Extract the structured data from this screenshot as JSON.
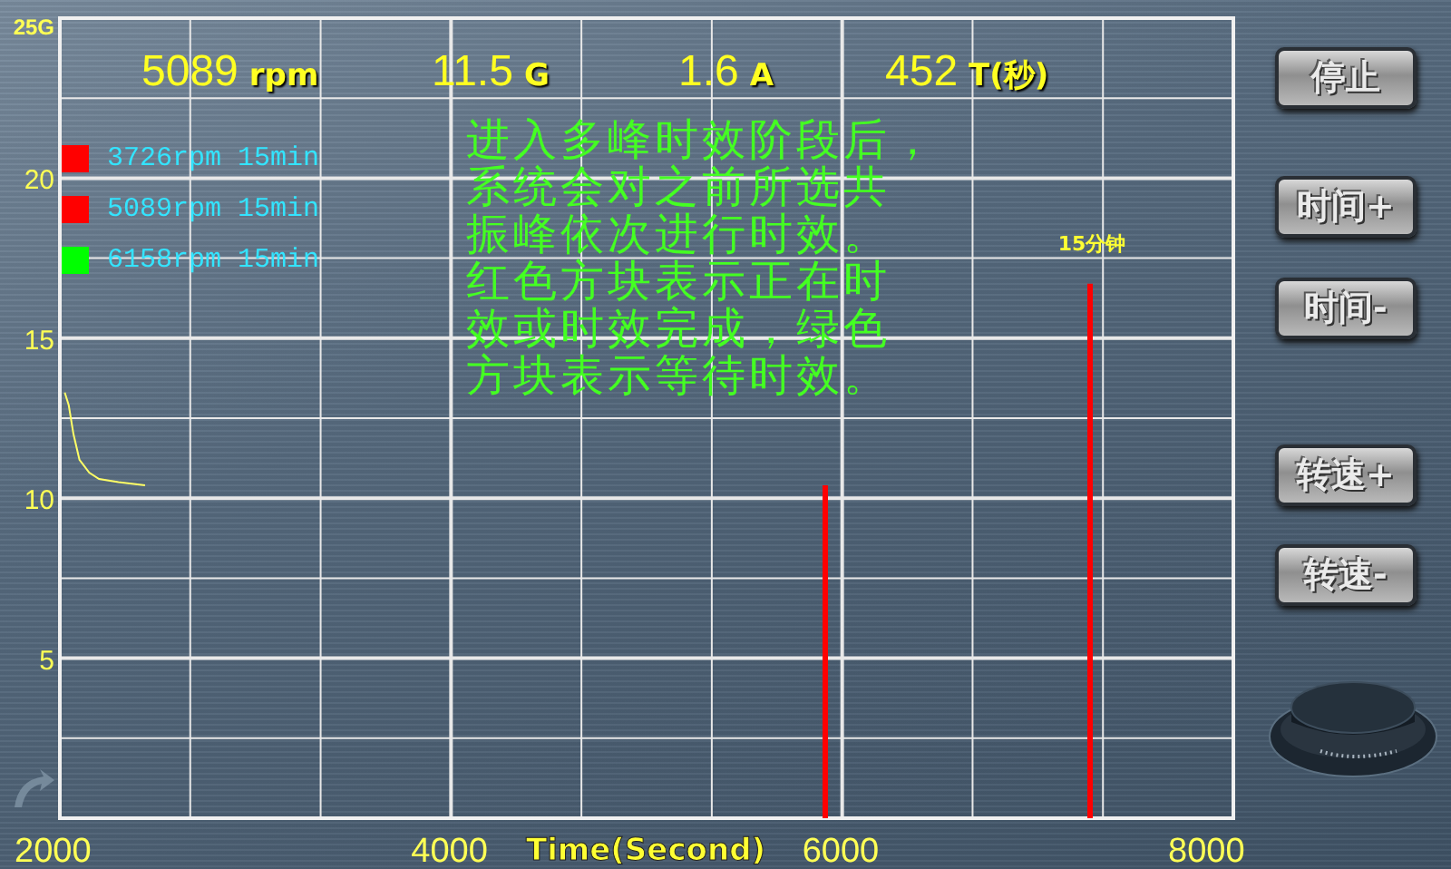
{
  "readouts": [
    {
      "value": "5089",
      "unit": "rpm"
    },
    {
      "value": "11.5",
      "unit": "G"
    },
    {
      "value": "1.6",
      "unit": "A"
    },
    {
      "value": "452",
      "unit": "T(秒)"
    }
  ],
  "legend": [
    {
      "label": "3726rpm 15min",
      "color": "#ff0000"
    },
    {
      "label": "5089rpm 15min",
      "color": "#ff0000"
    },
    {
      "label": "6158rpm 15min",
      "color": "#00ff00"
    }
  ],
  "description_lines": [
    "进入多峰时效阶段后，",
    "系统会对之前所选共",
    "振峰依次进行时效。",
    "红色方块表示正在时",
    "效或时效完成，绿色",
    "方块表示等待时效。"
  ],
  "chart": {
    "chart_data": {
      "type": "line",
      "xlabel": "Time(Second)",
      "xlim": [
        2000,
        8000
      ],
      "ylim": [
        0,
        25
      ],
      "xticks": [
        2000,
        4000,
        6000,
        8000
      ],
      "yticks": [
        5,
        10,
        15,
        20,
        {
          "value": 25,
          "label": "25G"
        }
      ],
      "grid": true,
      "series": [
        {
          "color": "#ffff66",
          "x": [
            2025,
            2045,
            2070,
            2100,
            2150,
            2200,
            2300,
            2436
          ],
          "values": [
            13.3,
            12.9,
            12.0,
            11.2,
            10.8,
            10.6,
            10.5,
            10.4
          ]
        },
        {
          "color": "#ff0000",
          "x": [
            5913,
            5913
          ],
          "values": [
            0,
            10.4
          ]
        },
        {
          "color": "#ff0000",
          "x": [
            7267,
            7267
          ],
          "values": [
            0,
            16.7
          ]
        }
      ]
    }
  },
  "marker_label": "15分钟",
  "buttons": [
    "停止",
    "时间+",
    "时间-",
    "转速+",
    "转速-"
  ]
}
